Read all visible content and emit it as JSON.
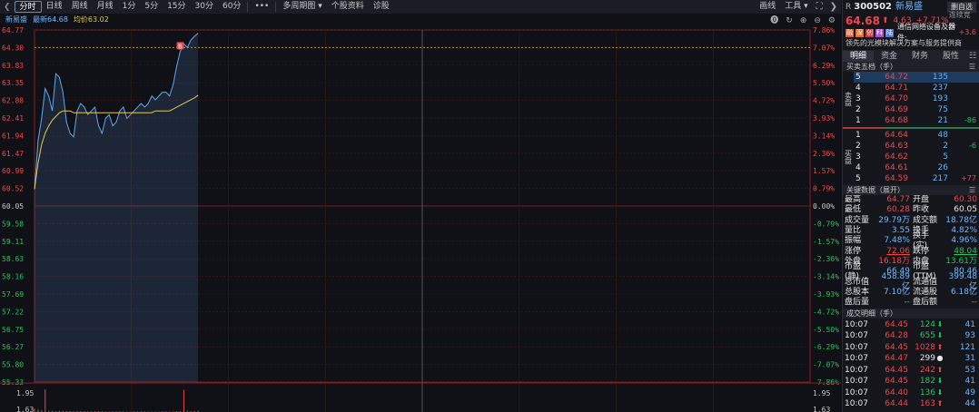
{
  "toolbar": {
    "items": [
      "分时",
      "日线",
      "周线",
      "月线",
      "1分",
      "5分",
      "15分",
      "30分",
      "60分",
      "•••",
      "多周期图 ▾",
      "个股资料",
      "诊股"
    ],
    "active_index": 0,
    "right": [
      "画线",
      "工具 ▾"
    ]
  },
  "chart_header": {
    "name": "新易盛",
    "latest_label": "最新",
    "latest": "64.68",
    "avg_label": "均价",
    "avg": "63.02"
  },
  "chart_data": {
    "type": "line",
    "prev_close": 60.05,
    "price_ticks": [
      "64.77",
      "64.30",
      "63.83",
      "63.35",
      "62.88",
      "62.41",
      "61.94",
      "61.47",
      "60.99",
      "60.52",
      "60.05",
      "59.58",
      "59.11",
      "58.63",
      "58.16",
      "57.69",
      "57.22",
      "56.75",
      "56.27",
      "55.80",
      "55.33"
    ],
    "pct_ticks": [
      "7.86%",
      "7.07%",
      "6.29%",
      "5.50%",
      "4.72%",
      "3.93%",
      "3.14%",
      "2.36%",
      "1.57%",
      "0.79%",
      "0.00%",
      "-0.79%",
      "-1.57%",
      "-2.36%",
      "-3.14%",
      "-3.93%",
      "-4.72%",
      "-5.50%",
      "-6.29%",
      "-7.07%",
      "-7.86%"
    ],
    "ylim": [
      55.33,
      64.77
    ],
    "limit_line": 64.3,
    "volume_ticks": [
      "1.95",
      "1.63"
    ],
    "series": [
      {
        "values": [
          60.5,
          61.8,
          62.4,
          63.2,
          63.0,
          62.6,
          63.6,
          63.5,
          63.1,
          62.3,
          62.0,
          61.9,
          62.6,
          62.8,
          62.7,
          62.5,
          62.6,
          62.7,
          62.2,
          62.0,
          62.4,
          62.5,
          62.2,
          62.3,
          62.6,
          62.7,
          62.4,
          62.5,
          62.6,
          62.7,
          62.8,
          62.7,
          62.8,
          63.0,
          62.9,
          63.0,
          63.1,
          63.1,
          63.0,
          63.3,
          63.8,
          64.2,
          64.4,
          64.3,
          64.5,
          64.6,
          64.68
        ]
      },
      {
        "values": [
          60.5,
          61.2,
          61.7,
          62.0,
          62.2,
          62.35,
          62.45,
          62.55,
          62.6,
          62.6,
          62.6,
          62.55,
          62.55,
          62.55,
          62.55,
          62.55,
          62.55,
          62.55,
          62.55,
          62.55,
          62.55,
          62.55,
          62.55,
          62.55,
          62.55,
          62.55,
          62.55,
          62.55,
          62.55,
          62.55,
          62.55,
          62.55,
          62.55,
          62.55,
          62.6,
          62.6,
          62.6,
          62.6,
          62.6,
          62.65,
          62.7,
          62.75,
          62.8,
          62.85,
          62.9,
          62.95,
          63.02
        ]
      }
    ],
    "volume": [
      0.3,
      0.2,
      0.15,
      1.95,
      0.1,
      0.1,
      0.08,
      0.1,
      0.1,
      0.09,
      0.08,
      0.07,
      0.1,
      0.08,
      0.07,
      0.06,
      0.06,
      0.07,
      0.08,
      0.06,
      0.05,
      0.05,
      0.06,
      0.05,
      0.06,
      0.05,
      0.05,
      0.04,
      0.05,
      0.05,
      0.06,
      0.05,
      0.06,
      0.05,
      0.05,
      0.05,
      0.06,
      0.05,
      0.05,
      0.06,
      0.07,
      0.08,
      1.9,
      0.1,
      0.08,
      0.09,
      0.1
    ],
    "marker": "B"
  },
  "stock": {
    "code": "300502",
    "name": "新易盛",
    "price": "64.68",
    "change": "4.63",
    "pct": "+7.71%",
    "add_watch": "删自选",
    "status": "连续竞价",
    "tags": [
      "融",
      "深",
      "创",
      "科",
      "陆"
    ],
    "industry": "通信网络设备及器件:",
    "industry_pct": "+3.6",
    "desc": "领先的光模块解决方案与服务提供商"
  },
  "tabs": [
    "明细",
    "资金",
    "财务",
    "股性"
  ],
  "orderbook": {
    "title": "买卖五档（手）",
    "sell_label": "卖盘",
    "buy_label": "买盘",
    "asks": [
      {
        "lvl": "5",
        "price": "64.72",
        "vol": "135",
        "chg": ""
      },
      {
        "lvl": "4",
        "price": "64.71",
        "vol": "237",
        "chg": ""
      },
      {
        "lvl": "3",
        "price": "64.70",
        "vol": "193",
        "chg": ""
      },
      {
        "lvl": "2",
        "price": "64.69",
        "vol": "75",
        "chg": ""
      },
      {
        "lvl": "1",
        "price": "64.68",
        "vol": "21",
        "chg": "-86"
      }
    ],
    "bids": [
      {
        "lvl": "1",
        "price": "64.64",
        "vol": "48",
        "chg": ""
      },
      {
        "lvl": "2",
        "price": "64.63",
        "vol": "2",
        "chg": "-6"
      },
      {
        "lvl": "3",
        "price": "64.62",
        "vol": "5",
        "chg": ""
      },
      {
        "lvl": "4",
        "price": "64.61",
        "vol": "26",
        "chg": ""
      },
      {
        "lvl": "5",
        "price": "64.59",
        "vol": "217",
        "chg": "+77"
      }
    ]
  },
  "key": {
    "title": "关键数据（展开）",
    "rows": [
      [
        "最高",
        "64.77",
        "red",
        "开盘",
        "60.30",
        "red"
      ],
      [
        "最低",
        "60.28",
        "red",
        "昨收",
        "60.05",
        "white"
      ],
      [
        "成交量",
        "29.79万",
        "cyan",
        "成交额",
        "18.78亿",
        "cyan"
      ],
      [
        "量比",
        "3.55",
        "cyan",
        "换手",
        "4.82%",
        "cyan"
      ],
      [
        "振幅",
        "7.48%",
        "cyan",
        "换手(实)",
        "4.96%",
        "cyan"
      ],
      [
        "涨停",
        "72.06",
        "red",
        "跌停",
        "48.04",
        "green"
      ],
      [
        "外盘",
        "16.18万",
        "red",
        "内盘",
        "13.61万",
        "green"
      ],
      [
        "市盈(静)",
        "66.49",
        "cyan",
        "市盈(TTM)",
        "80.46",
        "cyan"
      ],
      [
        "总市值",
        "458.89亿",
        "cyan",
        "流通值",
        "399.48亿",
        "cyan"
      ],
      [
        "总股本",
        "7.10亿",
        "cyan",
        "流通股",
        "6.18亿",
        "cyan"
      ],
      [
        "盘后量",
        "--",
        "gray",
        "盘后额",
        "--",
        "gray"
      ]
    ]
  },
  "trades": {
    "title": "成交明细（手）",
    "rows": [
      [
        "10:07",
        "64.45",
        "124",
        "down",
        "41"
      ],
      [
        "10:07",
        "64.28",
        "655",
        "down",
        "93"
      ],
      [
        "10:07",
        "64.45",
        "1028",
        "up",
        "121"
      ],
      [
        "10:07",
        "64.47",
        "299",
        "neutral",
        "31"
      ],
      [
        "10:07",
        "64.45",
        "242",
        "up",
        "53"
      ],
      [
        "10:07",
        "64.45",
        "182",
        "down",
        "41"
      ],
      [
        "10:07",
        "64.40",
        "136",
        "down",
        "49"
      ],
      [
        "10:07",
        "64.44",
        "163",
        "up",
        "44"
      ]
    ]
  }
}
